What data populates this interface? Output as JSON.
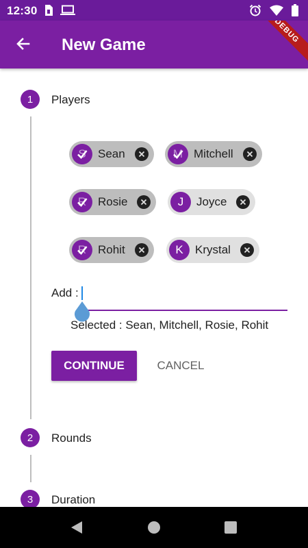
{
  "status_bar": {
    "time": "12:30"
  },
  "app_bar": {
    "title": "New Game",
    "debug_label": "DEBUG"
  },
  "steps": [
    {
      "number": "1",
      "label": "Players"
    },
    {
      "number": "2",
      "label": "Rounds"
    },
    {
      "number": "3",
      "label": "Duration"
    }
  ],
  "players": [
    {
      "initial": "S",
      "name": "Sean",
      "selected": true
    },
    {
      "initial": "M",
      "name": "Mitchell",
      "selected": true
    },
    {
      "initial": "R",
      "name": "Rosie",
      "selected": true
    },
    {
      "initial": "J",
      "name": "Joyce",
      "selected": false
    },
    {
      "initial": "R",
      "name": "Rohit",
      "selected": true
    },
    {
      "initial": "K",
      "name": "Krystal",
      "selected": false
    }
  ],
  "add_field": {
    "label": "Add :",
    "value": ""
  },
  "selected_summary": "Selected : Sean, Mitchell, Rosie, Rohit",
  "buttons": {
    "continue": "CONTINUE",
    "cancel": "CANCEL"
  },
  "colors": {
    "primary": "#7b1fa2",
    "status_bar": "#6a1b9a",
    "cursor": "#1e88e5",
    "ribbon": "#b71c1c"
  }
}
